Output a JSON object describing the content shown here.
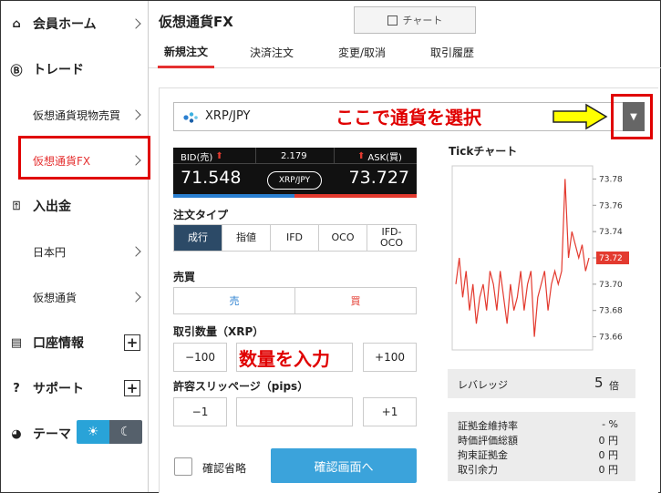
{
  "sidebar": {
    "home": "会員ホーム",
    "trade": "トレード",
    "spot": "仮想通貨現物売買",
    "fx": "仮想通貨FX",
    "deposit": "入出金",
    "jpy": "日本円",
    "crypto": "仮想通貨",
    "account": "口座情報",
    "support": "サポート",
    "theme": "テーマ"
  },
  "header": {
    "title": "仮想通貨FX",
    "chart_button": "チャート"
  },
  "tabs": [
    "新規注文",
    "決済注文",
    "変更/取消",
    "取引履歴"
  ],
  "pair": {
    "selected": "XRP/JPY"
  },
  "annotations": {
    "select_currency": "ここで通貨を選択",
    "enter_quantity": "数量を入力"
  },
  "quote": {
    "bid_label": "BID(売)",
    "spread": "2.179",
    "ask_label": "ASK(買)",
    "bid": "71.548",
    "pair": "XRP/JPY",
    "ask": "73.727"
  },
  "order_type": {
    "label": "注文タイプ",
    "options": [
      "成行",
      "指値",
      "IFD",
      "OCO",
      "IFD-OCO"
    ]
  },
  "side": {
    "label": "売買",
    "sell": "売",
    "buy": "買"
  },
  "quantity": {
    "label": "取引数量（XRP）",
    "minus": "−100",
    "plus": "+100"
  },
  "slippage": {
    "label": "許容スリッページ（pips）",
    "minus": "−1",
    "plus": "+1"
  },
  "confirm": {
    "skip_label": "確認省略",
    "button": "確認画面へ"
  },
  "tick_chart": {
    "title": "Tickチャート",
    "current": "73.72",
    "colors": {
      "line": "#e33a2f",
      "tag": "#e33a2f"
    }
  },
  "chart_data": {
    "type": "line",
    "title": "Tickチャート",
    "ylim": [
      73.65,
      73.79
    ],
    "yticks": [
      "73.78",
      "73.76",
      "73.74",
      "73.72",
      "73.70",
      "73.68",
      "73.66"
    ],
    "series": [
      {
        "values": [
          73.7,
          73.72,
          73.69,
          73.71,
          73.68,
          73.7,
          73.67,
          73.69,
          73.7,
          73.68,
          73.71,
          73.7,
          73.68,
          73.71,
          73.69,
          73.67,
          73.7,
          73.68,
          73.69,
          73.71,
          73.68,
          73.7,
          73.71,
          73.66,
          73.69,
          73.7,
          73.71,
          73.68,
          73.7,
          73.71,
          73.7,
          73.71,
          73.78,
          73.72,
          73.74,
          73.73,
          73.72,
          73.73,
          73.71,
          73.72
        ]
      }
    ]
  },
  "leverage": {
    "label": "レバレッジ",
    "value": "5",
    "unit": "倍"
  },
  "stats": [
    {
      "label": "証拠金維持率",
      "value": "- %"
    },
    {
      "label": "時価評価総額",
      "value": "0 円"
    },
    {
      "label": "拘束証拠金",
      "value": "0 円"
    },
    {
      "label": "取引余力",
      "value": "0 円"
    }
  ]
}
